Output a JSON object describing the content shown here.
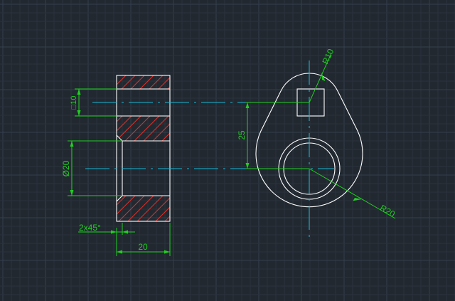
{
  "colors": {
    "background": "#212830",
    "grid_minor": "#2a323c",
    "grid_major": "#33404c",
    "outline": "#ffffff",
    "dimension": "#1fd11f",
    "centerline": "#18b7d6",
    "hatch": "#e0302a"
  },
  "dimensions": {
    "square": "□10",
    "bore_diameter": "Ø20",
    "chamfer": "2x45°",
    "thickness": "20",
    "center_distance": "25",
    "small_radius": "R10",
    "large_radius": "R20"
  }
}
